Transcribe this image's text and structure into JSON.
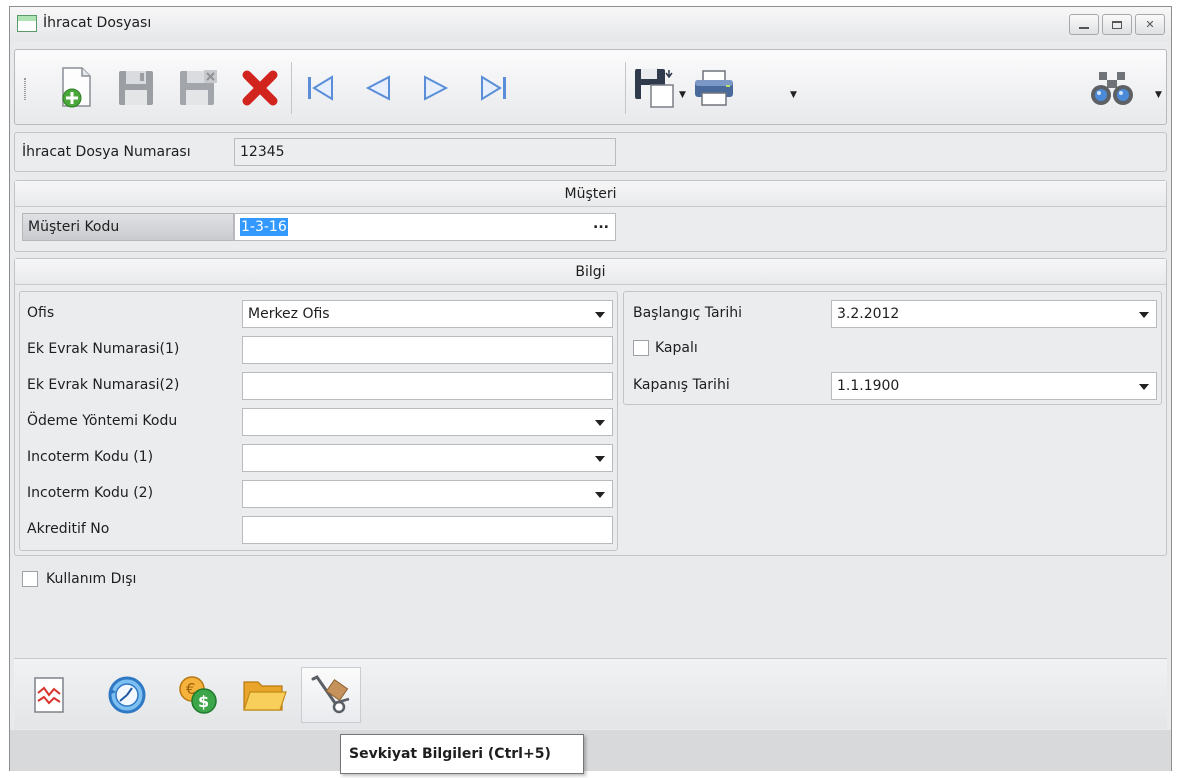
{
  "window": {
    "title": "İhracat Dosyası"
  },
  "title_buttons": [
    "minimize-icon",
    "maximize-icon",
    "close-icon"
  ],
  "toolbar": {
    "icons": [
      "new-record-icon",
      "save-icon",
      "save-all-icon",
      "delete-icon",
      "first-record-icon",
      "previous-record-icon",
      "next-record-icon",
      "last-record-icon",
      "export-icon",
      "print-icon",
      "search-binoculars-icon"
    ]
  },
  "file_no": {
    "label": "İhracat Dosya Numarası",
    "value": "12345"
  },
  "musteri": {
    "title": "Müşteri",
    "code_label": "Müşteri Kodu",
    "code_value": "1-3-16",
    "ellipsis": "..."
  },
  "bilgi": {
    "title": "Bilgi",
    "left_fields": [
      {
        "label": "Ofis",
        "value": "Merkez Ofis"
      },
      {
        "label": "Ek Evrak Numarasi(1)",
        "value": ""
      },
      {
        "label": "Ek Evrak Numarasi(2)",
        "value": ""
      },
      {
        "label": "Ödeme Yöntemi Kodu",
        "value": ""
      },
      {
        "label": "Incoterm Kodu (1)",
        "value": ""
      },
      {
        "label": "Incoterm Kodu (2)",
        "value": ""
      },
      {
        "label": "Akreditif No",
        "value": ""
      }
    ],
    "start_date": {
      "label": "Başlangıç Tarihi",
      "value": "3.2.2012"
    },
    "closed": {
      "label": "Kapalı",
      "checked": false
    },
    "close_date": {
      "label": "Kapanış Tarihi",
      "value": "1.1.1900"
    }
  },
  "unused": {
    "label": "Kullanım Dışı",
    "checked": false
  },
  "bottom_icons": [
    "chart-icon",
    "history-icon",
    "currency-icon",
    "folder-icon",
    "hand-truck-icon"
  ],
  "tooltip": {
    "text": "Sevkiyat Bilgileri (Ctrl+5)"
  }
}
